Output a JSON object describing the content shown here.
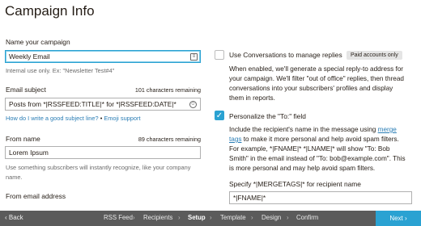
{
  "page": {
    "title": "Campaign Info"
  },
  "left": {
    "campaign_name": {
      "label": "Name your campaign",
      "value": "Weekly Email",
      "note": "Internal use only. Ex: \"Newsletter Test#4\""
    },
    "subject": {
      "label": "Email subject",
      "counter": "101 characters remaining",
      "value": "Posts from *|RSSFEED:TITLE|* for *|RSSFEED:DATE|*",
      "help_link": "How do I write a good subject line?",
      "separator": "•",
      "emoji_link": "Emoji support"
    },
    "from_name": {
      "label": "From name",
      "counter": "89 characters remaining",
      "value": "Lorem Ipsum",
      "note_line1": "Use something subscribers will instantly recognize, like your company",
      "note_line2": "name."
    },
    "from_email": {
      "label": "From email address"
    }
  },
  "right": {
    "conversations": {
      "title": "Use Conversations to manage replies",
      "badge": "Paid accounts only",
      "checked": false,
      "desc1": "When enabled, we'll generate a special reply-to address for",
      "desc2": "your campaign. We'll filter \"out of office\" replies, then thread",
      "desc3": "conversations into your subscribers' profiles and display",
      "desc4": "them in reports."
    },
    "personalize": {
      "title": "Personalize the \"To:\" field",
      "checked": true,
      "desc1_pre": "Include the recipient's name in the message using ",
      "desc1_link": "merge",
      "desc2_link": "tags",
      "desc2_post": " to make it more personal and help avoid spam filters.",
      "desc3": "For example, *|FNAME|* *|LNAME|* will show \"To: Bob",
      "desc4": "Smith\" in the email instead of \"To: bob@example.com\". This",
      "desc5": "is more personal and may help avoid spam filters.",
      "specify_label": "Specify *|MERGETAGS|* for recipient name",
      "specify_value": "*|FNAME|*"
    }
  },
  "bottom": {
    "back": "Back",
    "back_icon": "chevron-left",
    "steps": [
      "RSS Feed",
      "Recipients",
      "Setup",
      "Template",
      "Design",
      "Confirm"
    ],
    "active_step": "Setup",
    "next": "Next",
    "next_icon": "chevron-right"
  },
  "colors": {
    "accent": "#2aa2d2",
    "bar": "#5b5b5b",
    "link": "#2a7db5"
  }
}
